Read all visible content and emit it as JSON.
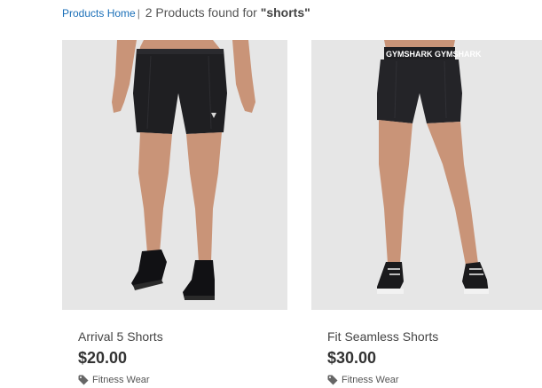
{
  "breadcrumb": {
    "home_label": "Products Home",
    "separator": "|",
    "result_text": "2 Products found for",
    "query": "\"shorts\""
  },
  "products": [
    {
      "name": "Arrival 5 Shorts",
      "price": "$20.00",
      "category": "Fitness Wear",
      "image_icon": "mens-shorts-photo"
    },
    {
      "name": "Fit Seamless Shorts",
      "price": "$30.00",
      "category": "Fitness Wear",
      "image_icon": "womens-shorts-photo",
      "waistband_text": "GYMSHARK GYMSHARK"
    }
  ],
  "colors": {
    "link": "#1a6fb8",
    "image_background": "#e6e6e6",
    "garment": "#1f1f22",
    "skin": "#c99478"
  }
}
